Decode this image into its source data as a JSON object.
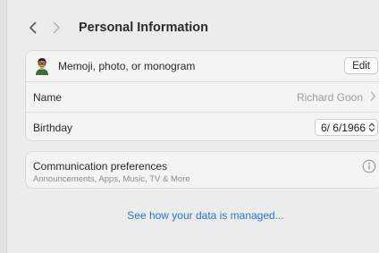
{
  "header": {
    "title": "Personal Information",
    "back_icon": "chevron-left-icon",
    "forward_icon": "chevron-right-icon"
  },
  "profile_card": {
    "memoji_row": {
      "label": "Memoji, photo, or monogram",
      "button_label": "Edit",
      "icon": "memoji-icon"
    },
    "name_row": {
      "label": "Name",
      "value": "Richard Goon",
      "icon": "chevron-right-icon"
    },
    "birthday_row": {
      "label": "Birthday",
      "value": "6/ 6/1966",
      "icon": "stepper-icon"
    }
  },
  "communication_card": {
    "title": "Communication preferences",
    "subtitle": "Announcements, Apps, Music, TV & More",
    "icon": "info-icon"
  },
  "footer": {
    "link_label": "See how your data is managed..."
  },
  "colors": {
    "accent": "#2a6fe0",
    "background": "#ececec",
    "card": "#f4f4f4"
  }
}
